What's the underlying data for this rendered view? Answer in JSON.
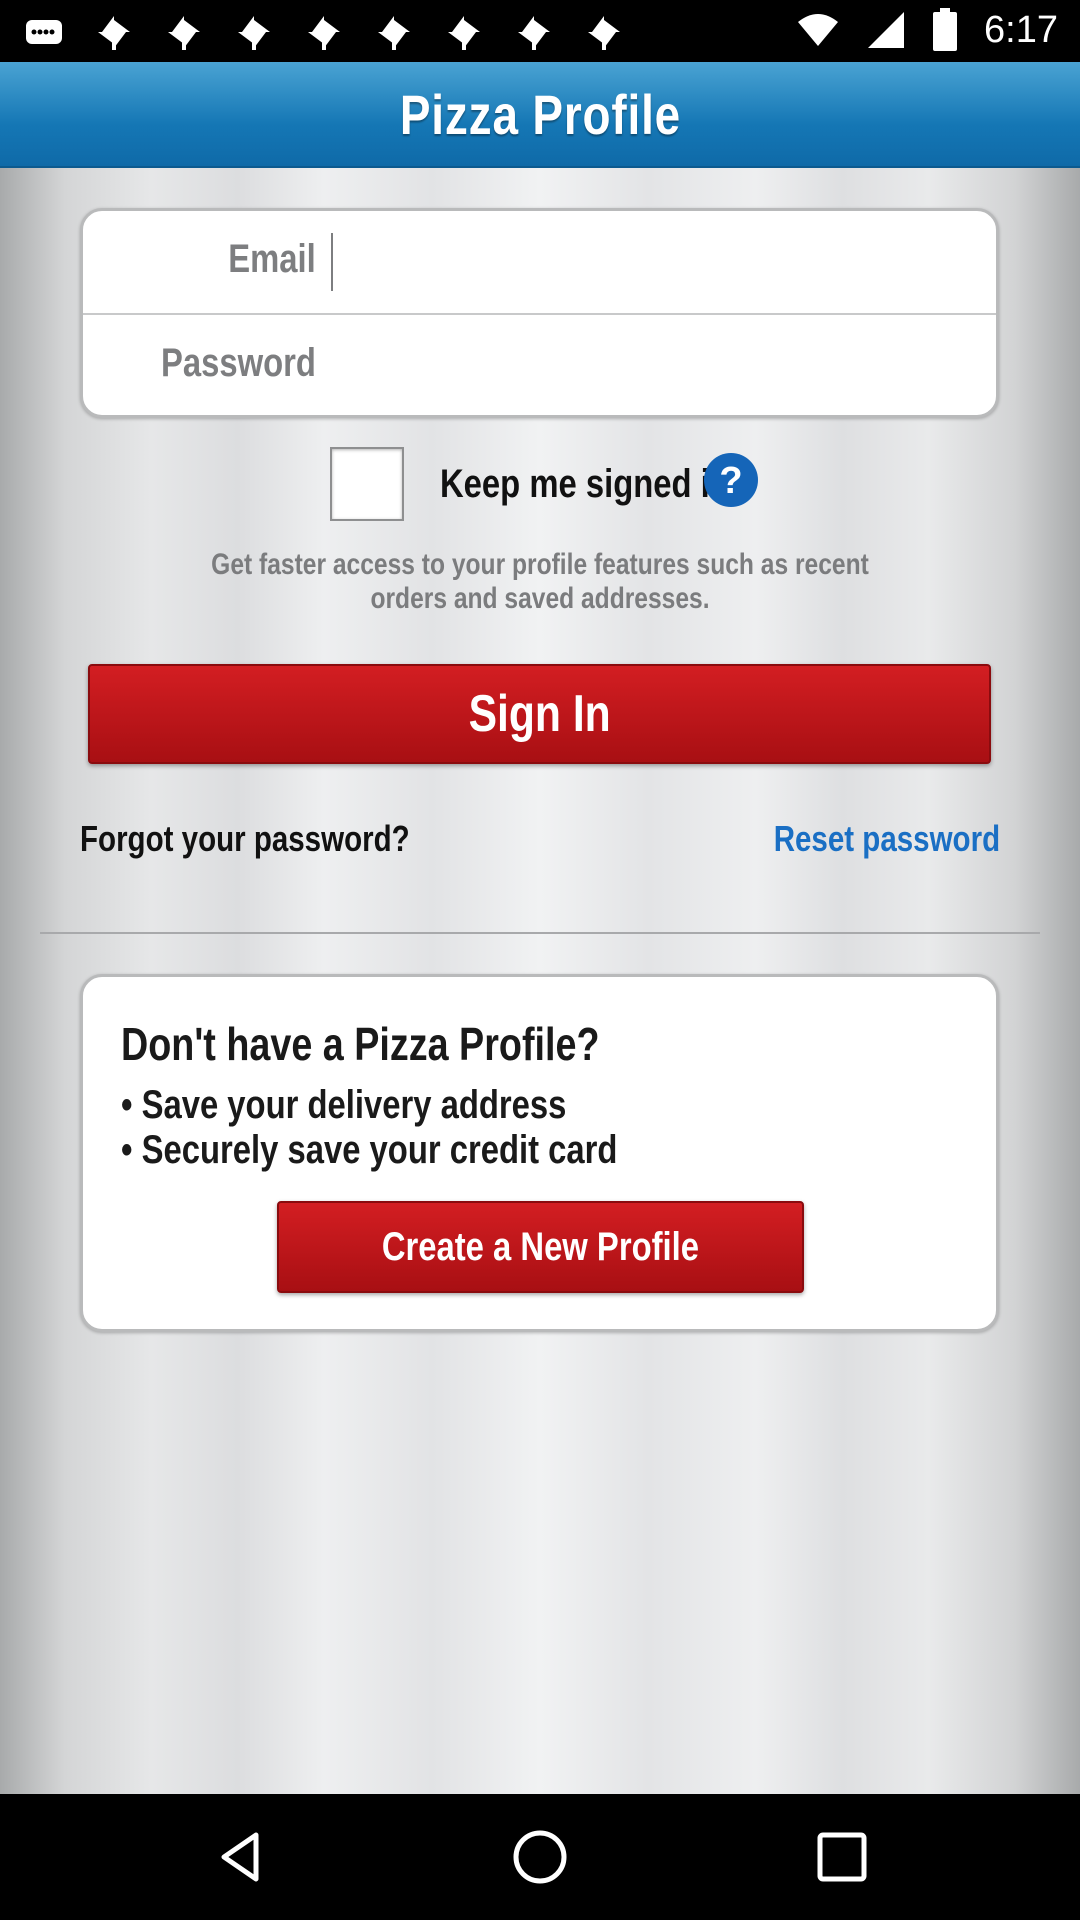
{
  "status_bar": {
    "time": "6:17",
    "notification_icons": [
      "message-icon",
      "pinwheel-icon",
      "pinwheel-icon",
      "pinwheel-icon",
      "pinwheel-icon",
      "pinwheel-icon",
      "pinwheel-icon",
      "pinwheel-icon",
      "pinwheel-icon"
    ],
    "system_icons": [
      "wifi-icon",
      "signal-icon",
      "battery-icon"
    ]
  },
  "header": {
    "title": "Pizza Profile"
  },
  "login": {
    "email_label": "Email",
    "email_value": "",
    "password_label": "Password",
    "password_value": "",
    "keep_signed_in_label": "Keep me signed in",
    "keep_signed_in_checked": false,
    "hint": "Get faster access to your profile features such as recent orders and saved addresses.",
    "sign_in_label": "Sign In",
    "forgot_label": "Forgot your password?",
    "reset_label": "Reset password"
  },
  "promo": {
    "title": "Don't have a Pizza Profile?",
    "bullets": [
      "• Save your delivery address",
      "• Securely save your credit card"
    ],
    "create_label": "Create a New Profile"
  },
  "colors": {
    "header_blue": "#1577b5",
    "button_red": "#b8151a",
    "link_blue": "#1a6fc4",
    "help_blue": "#1565b8"
  },
  "nav_bar": {
    "icons": [
      "back-icon",
      "home-icon",
      "recents-icon"
    ]
  }
}
